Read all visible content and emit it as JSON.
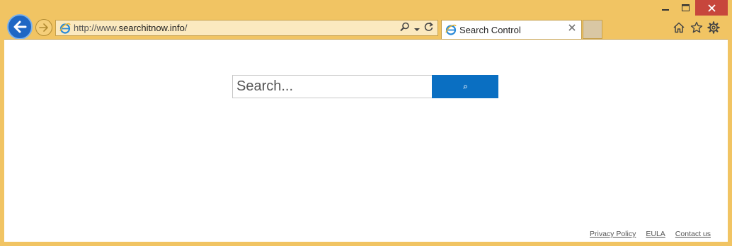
{
  "browser": {
    "address_bar": {
      "url_prefix": "http://www.",
      "url_domain": "searchitnow.info",
      "url_suffix": "/"
    },
    "tab": {
      "title": "Search Control"
    },
    "accent_color": "#1e67c4",
    "frame_color": "#f1c463"
  },
  "page": {
    "search": {
      "placeholder": "Search...",
      "button_color": "#0a6fc2"
    },
    "footer": {
      "links": [
        "Privacy Policy",
        "EULA",
        "Contact us"
      ]
    }
  },
  "icons": [
    "back-arrow-icon",
    "forward-arrow-icon",
    "ie-logo-icon",
    "search-icon",
    "dropdown-icon",
    "refresh-icon",
    "close-icon",
    "home-icon",
    "star-icon",
    "gear-icon",
    "minimize-icon",
    "maximize-icon"
  ]
}
